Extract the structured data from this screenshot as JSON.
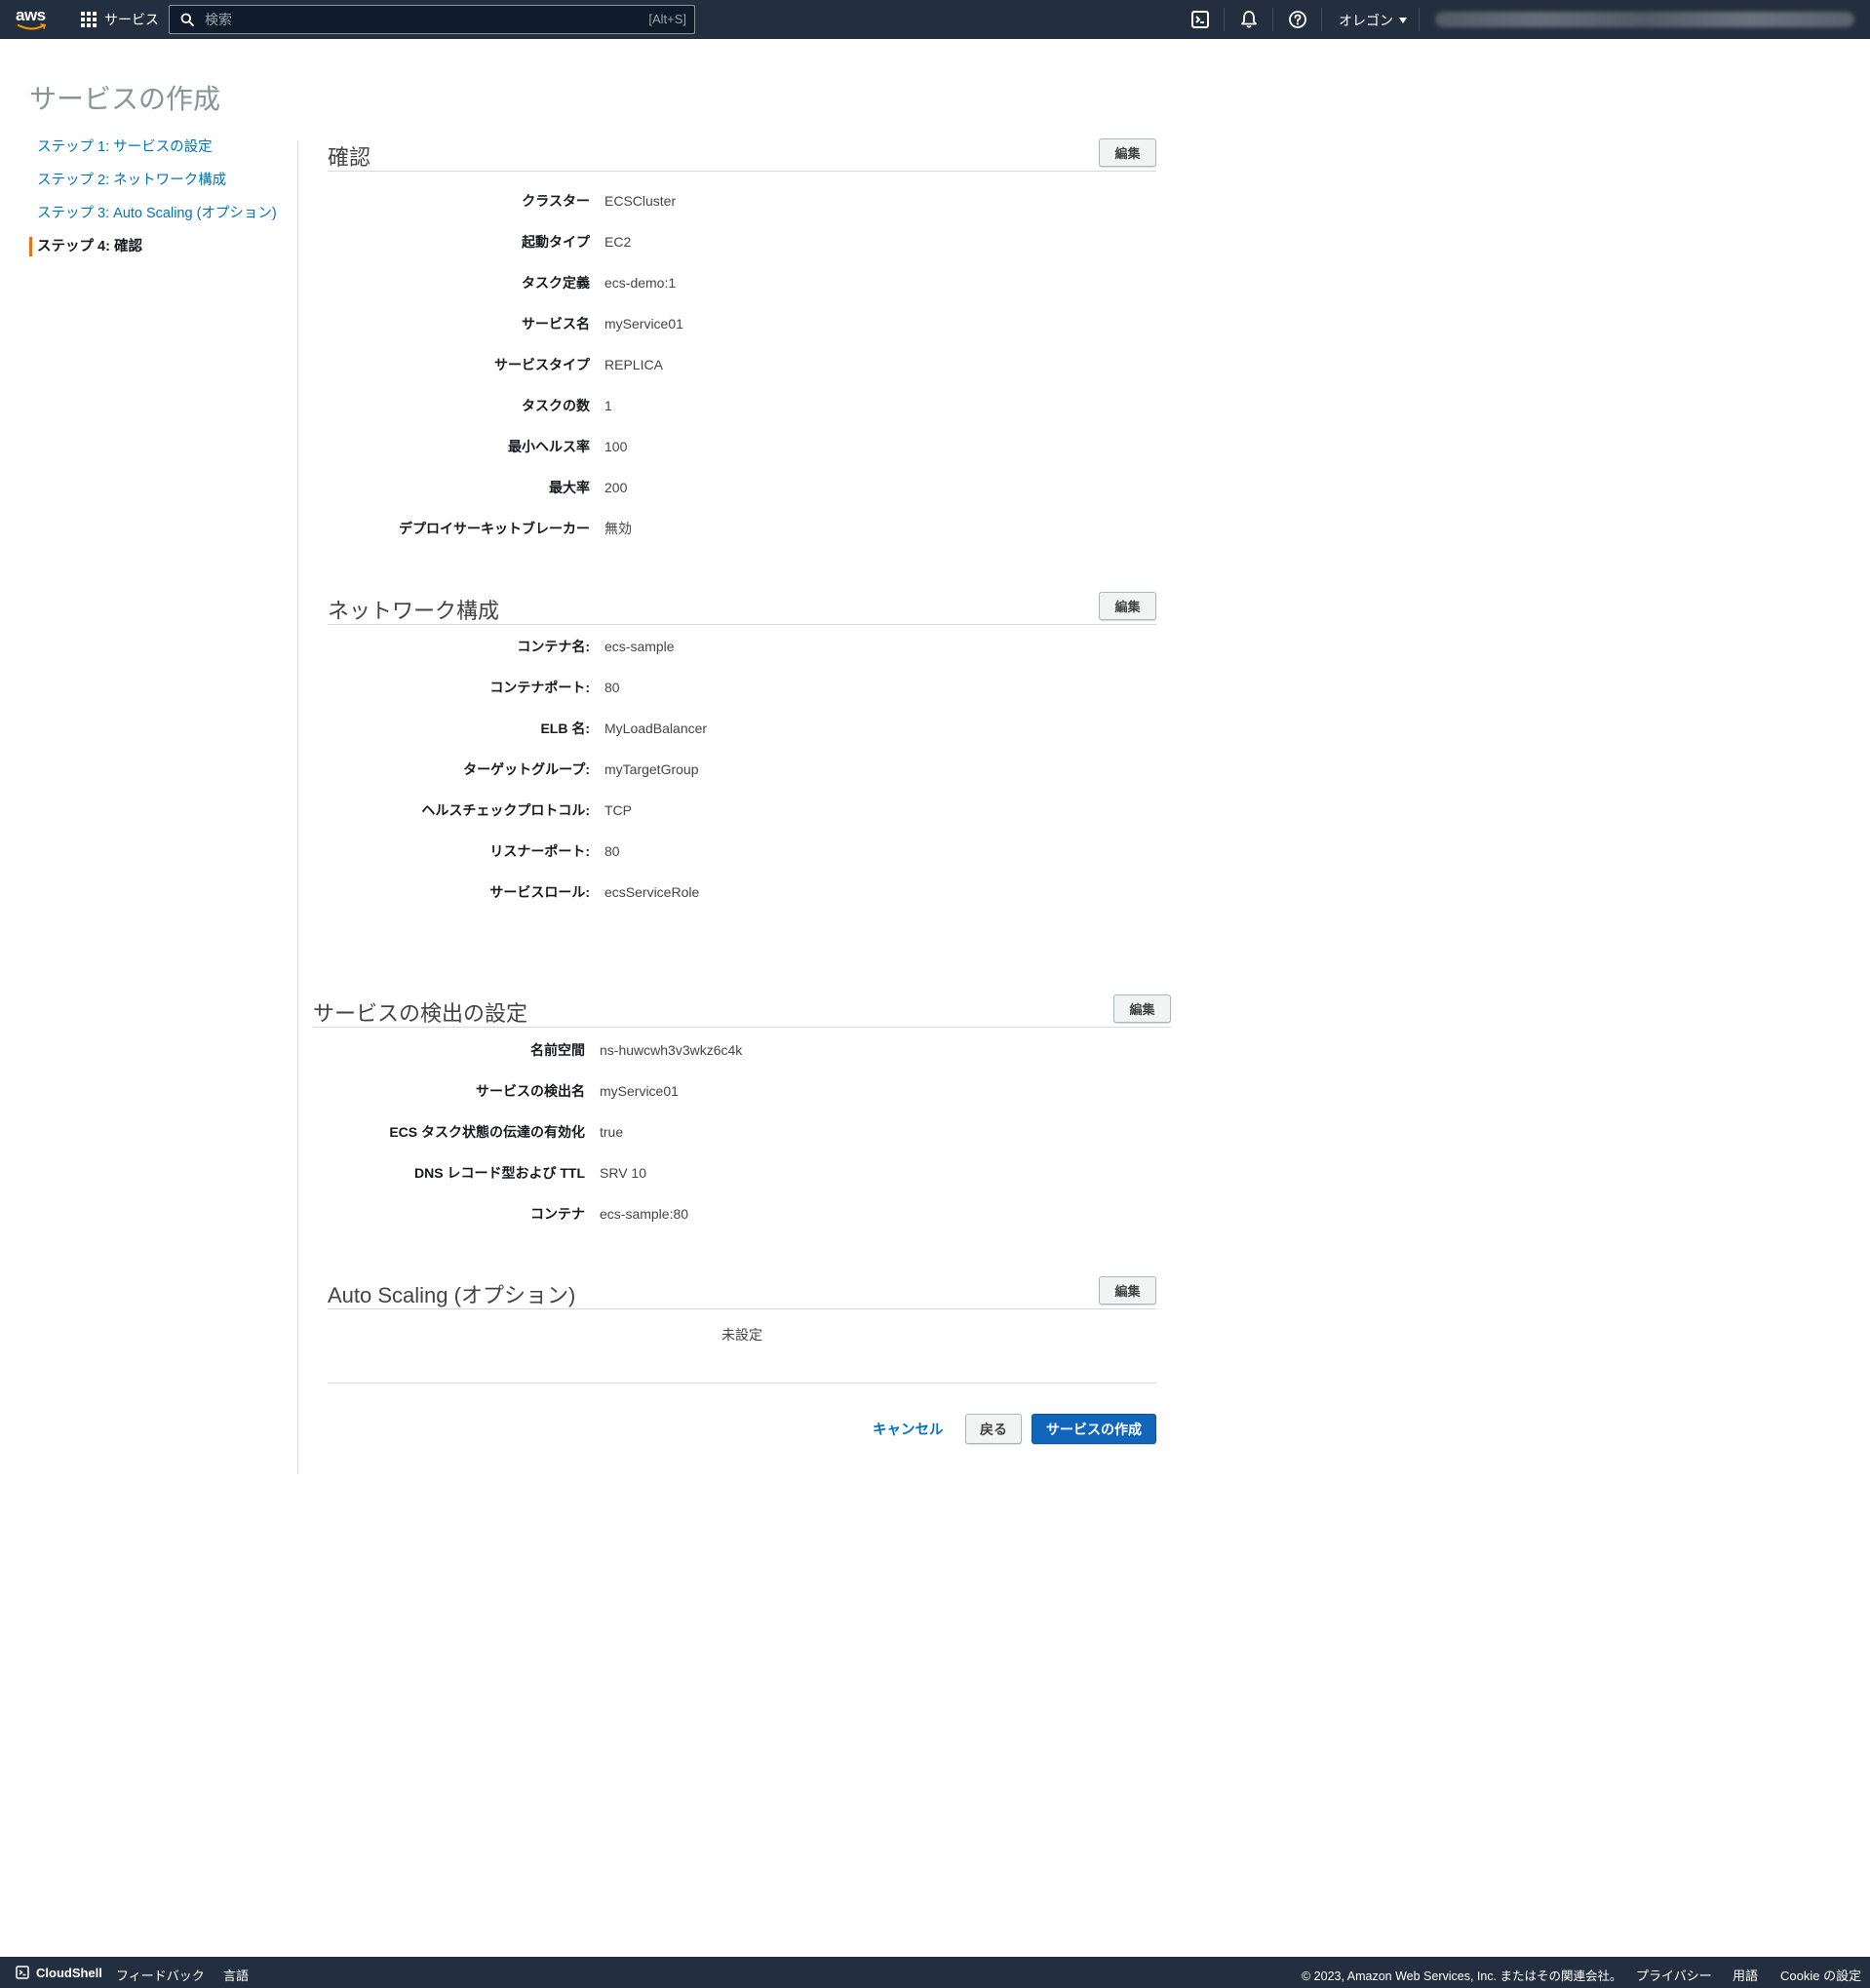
{
  "nav": {
    "logo_text": "aws",
    "services_label": "サービス",
    "search_placeholder": "検索",
    "search_shortcut": "[Alt+S]",
    "region_label": "オレゴン"
  },
  "page": {
    "title": "サービスの作成"
  },
  "steps": [
    {
      "label": "ステップ 1: サービスの設定"
    },
    {
      "label": "ステップ 2: ネットワーク構成"
    },
    {
      "label": "ステップ 3: Auto Scaling (オプション)"
    },
    {
      "label": "ステップ 4: 確認"
    }
  ],
  "sections": {
    "review": {
      "title": "確認",
      "edit_label": "編集",
      "rows": [
        {
          "label": "クラスター",
          "value": "ECSCluster"
        },
        {
          "label": "起動タイプ",
          "value": "EC2"
        },
        {
          "label": "タスク定義",
          "value": "ecs-demo:1"
        },
        {
          "label": "サービス名",
          "value": "myService01"
        },
        {
          "label": "サービスタイプ",
          "value": "REPLICA"
        },
        {
          "label": "タスクの数",
          "value": "1"
        },
        {
          "label": "最小ヘルス率",
          "value": "100"
        },
        {
          "label": "最大率",
          "value": "200"
        },
        {
          "label": "デプロイサーキットブレーカー",
          "value": "無効"
        }
      ]
    },
    "network": {
      "title": "ネットワーク構成",
      "edit_label": "編集",
      "rows": [
        {
          "label": "コンテナ名:",
          "value": "ecs-sample"
        },
        {
          "label": "コンテナポート:",
          "value": "80"
        },
        {
          "label": "ELB 名:",
          "value": "MyLoadBalancer"
        },
        {
          "label": "ターゲットグループ:",
          "value": "myTargetGroup"
        },
        {
          "label": "ヘルスチェックプロトコル:",
          "value": "TCP"
        },
        {
          "label": "リスナーポート:",
          "value": "80"
        },
        {
          "label": "サービスロール:",
          "value": "ecsServiceRole"
        }
      ]
    },
    "discovery": {
      "title": "サービスの検出の設定",
      "edit_label": "編集",
      "rows": [
        {
          "label": "名前空間",
          "value": "ns-huwcwh3v3wkz6c4k"
        },
        {
          "label": "サービスの検出名",
          "value": "myService01"
        },
        {
          "label": "ECS タスク状態の伝達の有効化",
          "value": "true"
        },
        {
          "label": "DNS レコード型および TTL",
          "value": "SRV 10"
        },
        {
          "label": "コンテナ",
          "value": "ecs-sample:80"
        }
      ]
    },
    "autoscaling": {
      "title": "Auto Scaling (オプション)",
      "edit_label": "編集",
      "unset_text": "未設定"
    }
  },
  "actions": {
    "cancel": "キャンセル",
    "back": "戻る",
    "create": "サービスの作成"
  },
  "footer": {
    "cloudshell": "CloudShell",
    "feedback": "フィードバック",
    "language": "言語",
    "copyright": "© 2023, Amazon Web Services, Inc. またはその関連会社。",
    "privacy": "プライバシー",
    "terms": "用語",
    "cookie": "Cookie の設定"
  },
  "colors": {
    "nav_bg": "#232f3e",
    "link": "#0073bb",
    "primary_button": "#1166bb",
    "active_step_marker": "#ec7211"
  },
  "icons": [
    "aws-logo",
    "grid-icon",
    "search-icon",
    "cloudshell-icon",
    "bell-icon",
    "help-icon",
    "caret-down-icon"
  ]
}
